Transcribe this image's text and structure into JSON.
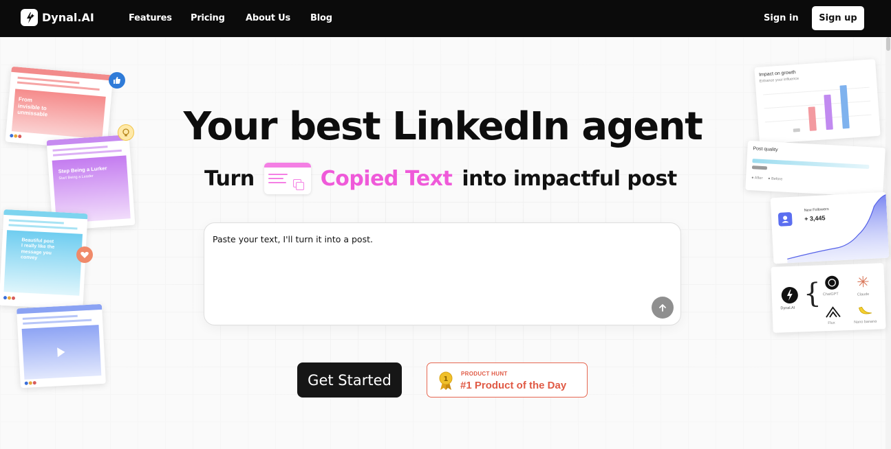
{
  "nav": {
    "brand": "Dynal.AI",
    "links": [
      "Features",
      "Pricing",
      "About Us",
      "Blog"
    ],
    "sign_in": "Sign in",
    "sign_up": "Sign up"
  },
  "hero": {
    "title": "Your best LinkedIn agent",
    "subtitle_prefix": "Turn",
    "subtitle_highlight": "Copied Text",
    "subtitle_suffix": "into impactful post"
  },
  "prompt": {
    "text": "Paste your text, I'll turn it into a post."
  },
  "cta": {
    "get_started": "Get Started",
    "ph_kicker": "PRODUCT HUNT",
    "ph_title": "#1 Product of the Day",
    "ph_rank": "1"
  },
  "left_cards": {
    "card1_text": "From\ninvisible to\nunmissable",
    "card2_text": "Step Being a Lurker",
    "card2_sub": "Start Being a Leader",
    "card3_text": "Beautiful post\nI really like the\nmessage you\nconvey"
  },
  "right_cards": {
    "growth_title": "Impact on growth",
    "growth_sub": "Enhance your influence",
    "growth_values": [
      0.08,
      0.55,
      0.8,
      0.98
    ],
    "quality_title": "Post quality",
    "quality_after": "After",
    "quality_before": "Before",
    "followers_title": "New Followers",
    "followers_value": "+ 3,445",
    "models": {
      "center": "Dynal.AI",
      "chatgpt": "ChatGPT",
      "claude": "Claude",
      "flux": "Flux",
      "banana": "Nano banana"
    }
  },
  "colors": {
    "nav_bg": "#0b0b0b",
    "accent_pink": "#ef5ad9",
    "ph_orange": "#e05a45",
    "cta_dark": "#161616"
  }
}
